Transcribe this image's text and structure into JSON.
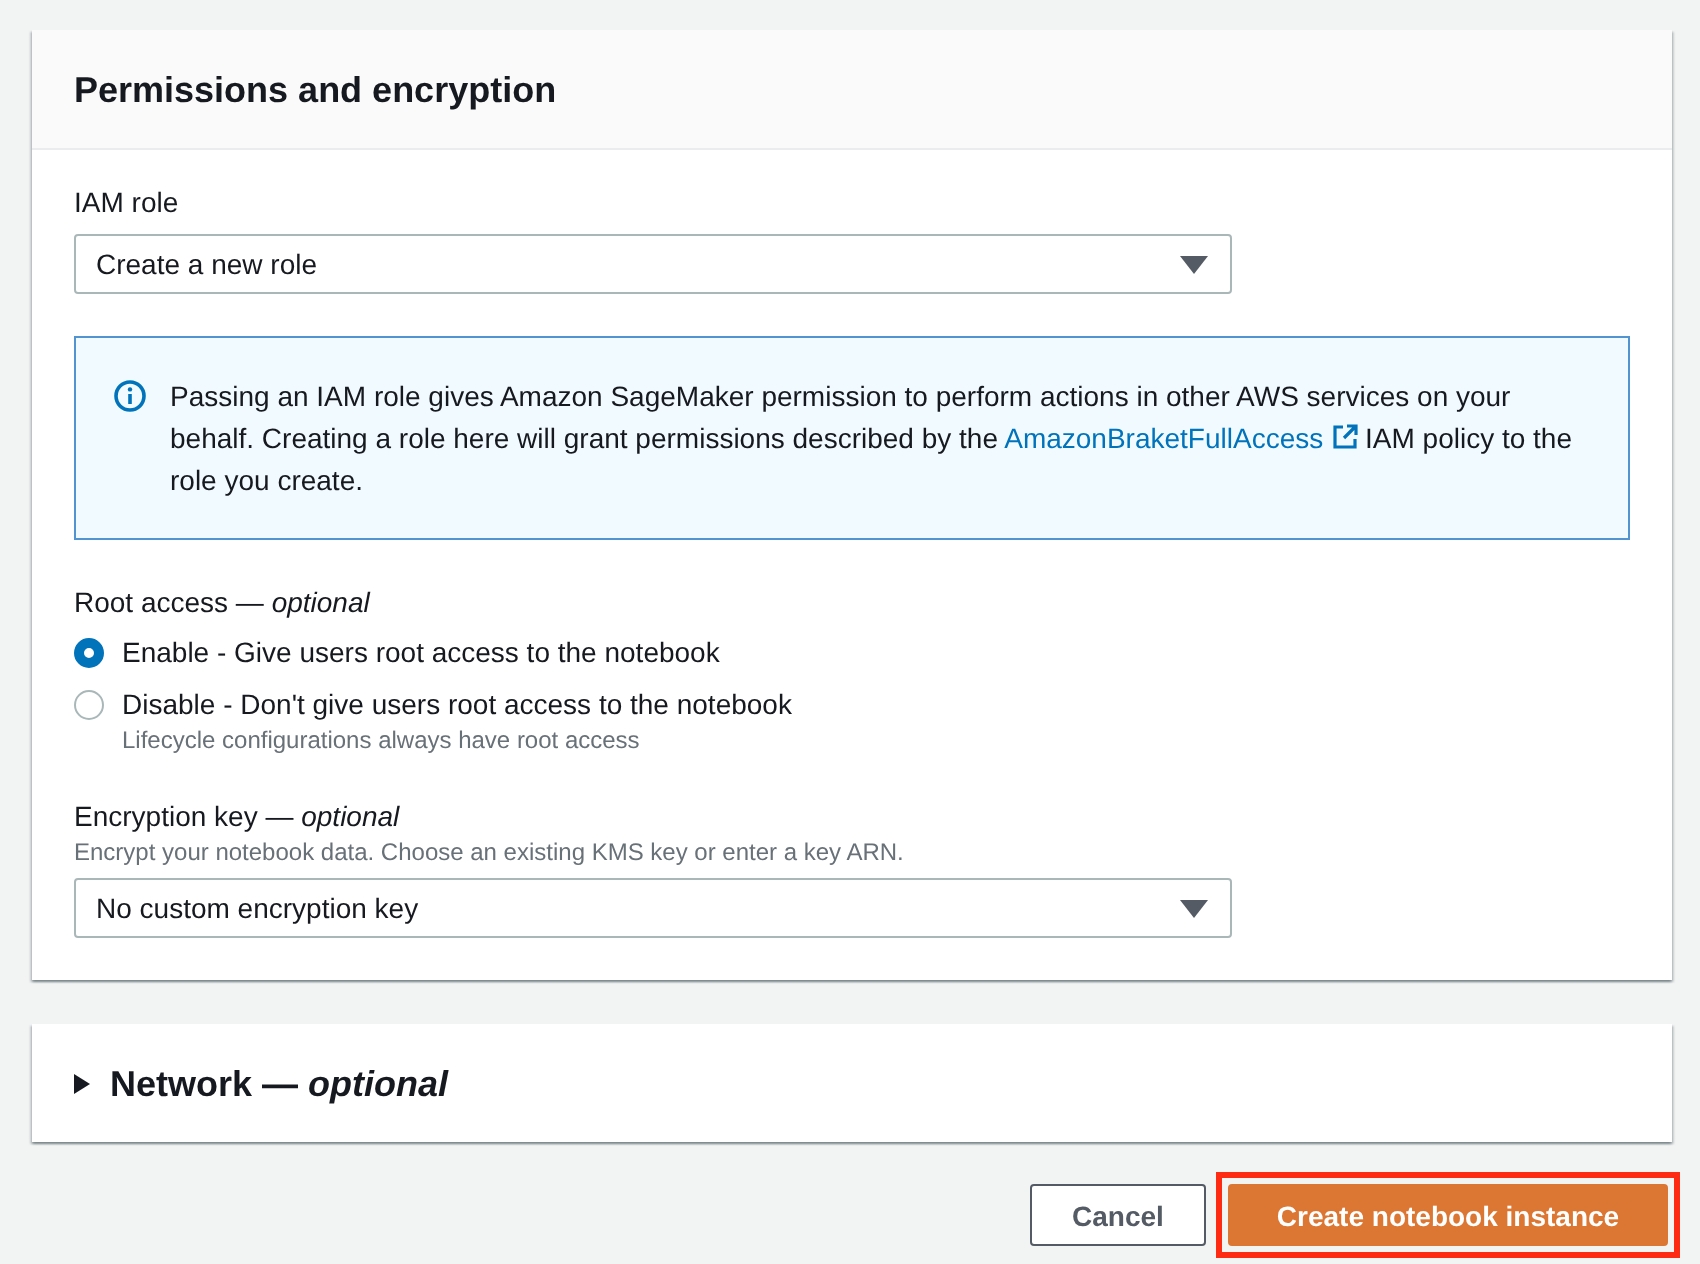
{
  "section": {
    "title": "Permissions and encryption"
  },
  "iam_role": {
    "label": "IAM role",
    "value": "Create a new role"
  },
  "info": {
    "text_before": "Passing an IAM role gives Amazon SageMaker permission to perform actions in other AWS services on your behalf. Creating a role here will grant permissions described by the",
    "link": "AmazonBraketFullAccess",
    "text_after": "IAM policy to the role you create."
  },
  "root_access": {
    "label": "Root access — *optional*",
    "options": [
      {
        "label": "Enable - Give users root access to the notebook",
        "selected": true
      },
      {
        "label": "Disable - Don't give users root access to the notebook",
        "description": "Lifecycle configurations always have root access",
        "selected": false
      }
    ]
  },
  "encryption_key": {
    "label": "Encryption key — *optional*",
    "description": "Encrypt your notebook data. Choose an existing KMS key or enter a key ARN.",
    "value": "No custom encryption key"
  },
  "network": {
    "title": "Network — *optional*",
    "expanded": false
  },
  "buttons": [
    {
      "label": "Cancel",
      "kind": "secondary",
      "highlighted": false
    },
    {
      "label": "Create notebook instance",
      "kind": "primary",
      "highlighted": true
    }
  ]
}
